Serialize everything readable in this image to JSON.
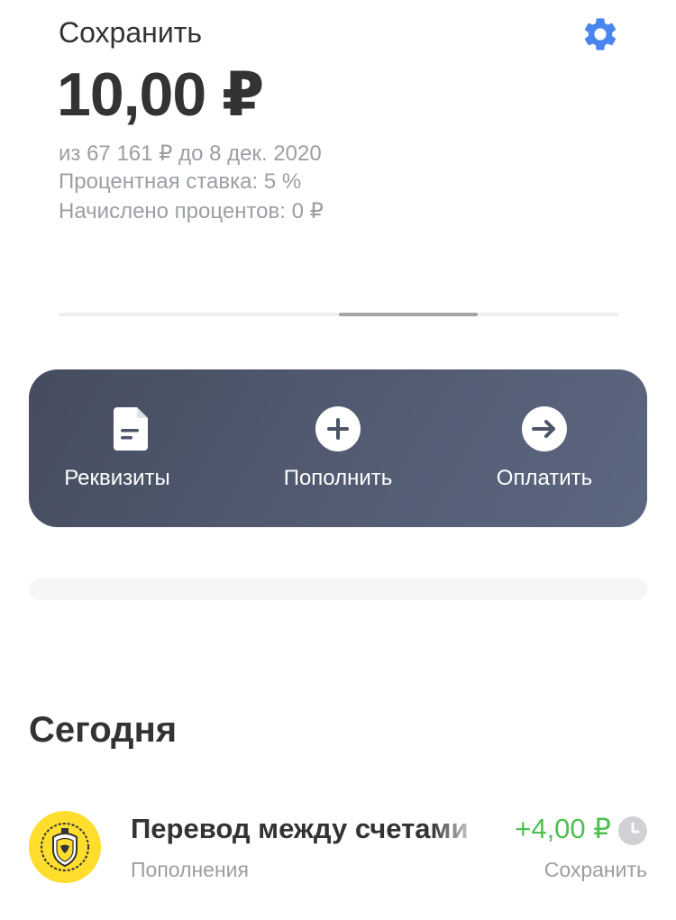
{
  "header": {
    "account_name": "Сохранить",
    "settings_icon": "gear-icon",
    "accent_color": "#4a86f0"
  },
  "balance": {
    "amount": "10,00 ₽"
  },
  "details": {
    "goal_line": "из 67 161 ₽ до 8 дек. 2020",
    "rate_line": "Процентная ставка: 5 %",
    "interest_line": "Начислено процентов: 0 ₽"
  },
  "pager": {
    "page": 3,
    "pages": 4
  },
  "actions": [
    {
      "label": "Реквизиты",
      "icon": "document-icon"
    },
    {
      "label": "Пополнить",
      "icon": "plus-circle-icon"
    },
    {
      "label": "Оплатить",
      "icon": "arrow-right-circle-icon"
    }
  ],
  "operations_section": {
    "title": "Сегодня",
    "items": [
      {
        "title": "Перевод между счетами",
        "category": "Пополнения",
        "amount": "+4,00 ₽",
        "account": "Сохранить",
        "logo_icon": "bank-logo-icon",
        "status_icon": "clock-icon",
        "amount_color": "#4fbf4f"
      }
    ]
  }
}
